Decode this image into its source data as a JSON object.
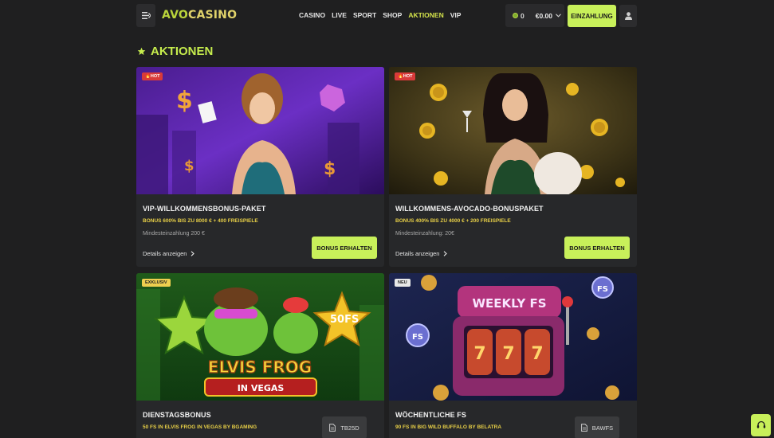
{
  "header": {
    "logo_left": "AVO",
    "logo_right": "CASINO",
    "nav": [
      {
        "label": "CASINO",
        "active": false
      },
      {
        "label": "LIVE",
        "active": false
      },
      {
        "label": "SPORT",
        "active": false
      },
      {
        "label": "SHOP",
        "active": false
      },
      {
        "label": "AKTIONEN",
        "active": true
      },
      {
        "label": "VIP",
        "active": false
      }
    ],
    "coins": "0",
    "balance": "€0.00",
    "deposit_label": "EINZAHLUNG"
  },
  "page": {
    "title": "AKTIONEN"
  },
  "cards": [
    {
      "badge": "🔥HOT",
      "title": "VIP-WILLKOMMENSBONUS-PAKET",
      "bonus": "BONUS 600% BIS ZU 8000 € + 400 FREISPIELE",
      "min_deposit": "Mindesteinzahlung 200 €",
      "details": "Details anzeigen",
      "button": "BONUS ERHALTEN"
    },
    {
      "badge": "🔥HOT",
      "title": "WILLKOMMENS-AVOCADO-BONUSPAKET",
      "bonus": "BONUS 400% BIS ZU 4000 € + 200 FREISPIELE",
      "min_deposit": "Mindesteinzahlung: 20€",
      "details": "Details anzeigen",
      "button": "BONUS ERHALTEN"
    },
    {
      "badge": "EXKLUSIV",
      "image_text_top": "ELVIS FROG",
      "image_text_bottom": "IN VEGAS",
      "image_star": "50FS",
      "title": "DIENSTAGSBONUS",
      "bonus": "50 FS IN ELVIS FROG IN VEGAS BY BGAMING",
      "code": "TB25D"
    },
    {
      "badge": "NEU",
      "image_text": "WEEKLY FS",
      "title": "WÖCHENTLICHE FS",
      "bonus": "90 FS IN BIG WILD BUFFALO BY BELATRA",
      "code": "BAWFS"
    }
  ],
  "colors": {
    "accent_green": "#c8f05a",
    "bonus_yellow": "#e7cf47",
    "hot_red": "#d83a3a",
    "background": "#1f1f20",
    "card": "#27282a"
  }
}
